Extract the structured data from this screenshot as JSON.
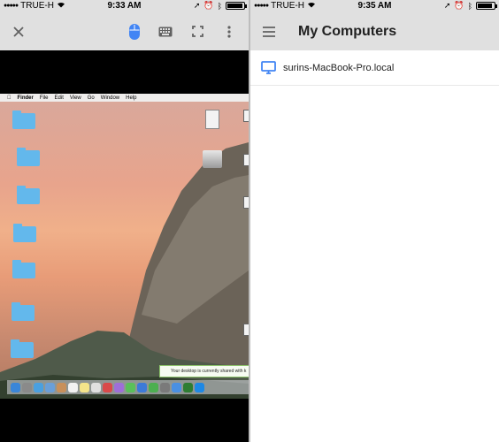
{
  "left_status": {
    "carrier": "TRUE-H",
    "time": "9:33 AM",
    "battery_level": 0.85
  },
  "right_status": {
    "carrier": "TRUE-H",
    "time": "9:35 AM",
    "battery_level": 0.8
  },
  "remote_toolbar": {
    "icons": [
      "close-icon",
      "mouse-icon",
      "keyboard-icon",
      "fullscreen-icon",
      "more-vert-icon"
    ],
    "mouse_icon_color": "#4285f4"
  },
  "remote_desktop": {
    "menubar": {
      "app": "Finder",
      "items": [
        "File",
        "Edit",
        "View",
        "Go",
        "Window",
        "Help"
      ]
    },
    "share_notice": "Your desktop is currently shared with k"
  },
  "computers_screen": {
    "title": "My Computers",
    "computers": [
      {
        "name": "surins-MacBook-Pro.local",
        "icon": "desktop-icon",
        "icon_color": "#4285f4"
      }
    ]
  },
  "colors": {
    "appbar": "#e0e0e0",
    "accent": "#4285f4"
  }
}
